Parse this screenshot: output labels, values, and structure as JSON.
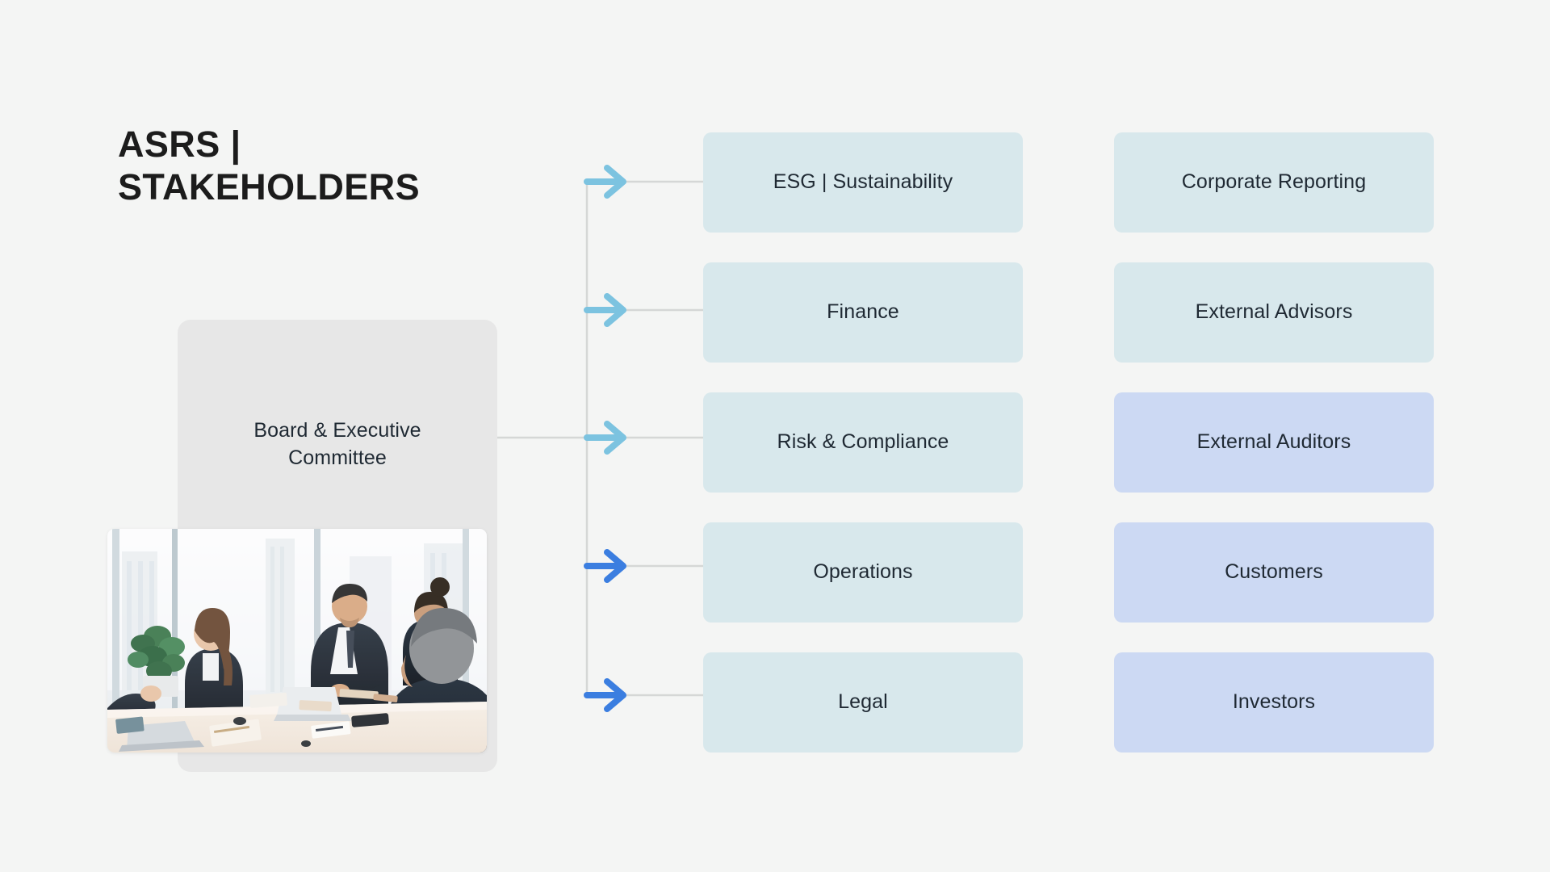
{
  "slide": {
    "background_color": "#f4f5f4",
    "title": {
      "line1": "ASRS |",
      "line2": "STAKEHOLDERS"
    },
    "source_node": {
      "label": "Board & Executive Committee",
      "card_color": "#e7e7e7",
      "photo_alt": "Business meeting in a boardroom with executives around a conference table"
    },
    "colors": {
      "teal": "#d8e8ec",
      "lavender": "#ccd9f3",
      "arrow_light": "#7cc3e0",
      "arrow_strong": "#3b7ee0",
      "connector_line": "#d5d7d6",
      "text": "#1f2933",
      "title_text": "#1c1c1c"
    },
    "columns": [
      {
        "id": "internal",
        "nodes": [
          {
            "label": "ESG | Sustainability",
            "color": "teal"
          },
          {
            "label": "Finance",
            "color": "teal"
          },
          {
            "label": "Risk & Compliance",
            "color": "teal"
          },
          {
            "label": "Operations",
            "color": "teal"
          },
          {
            "label": "Legal",
            "color": "teal"
          }
        ]
      },
      {
        "id": "external",
        "nodes": [
          {
            "label": "Corporate Reporting",
            "color": "teal"
          },
          {
            "label": "External Advisors",
            "color": "teal"
          },
          {
            "label": "External Auditors",
            "color": "lavender"
          },
          {
            "label": "Customers",
            "color": "lavender"
          },
          {
            "label": "Investors",
            "color": "lavender"
          }
        ]
      }
    ],
    "connectors": [
      {
        "row": 1,
        "arrow_color": "#7cc3e0",
        "style": "light"
      },
      {
        "row": 2,
        "arrow_color": "#7cc3e0",
        "style": "light"
      },
      {
        "row": 3,
        "arrow_color": "#7cc3e0",
        "style": "light"
      },
      {
        "row": 4,
        "arrow_color": "#3b7ee0",
        "style": "strong"
      },
      {
        "row": 5,
        "arrow_color": "#3b7ee0",
        "style": "strong"
      }
    ]
  }
}
